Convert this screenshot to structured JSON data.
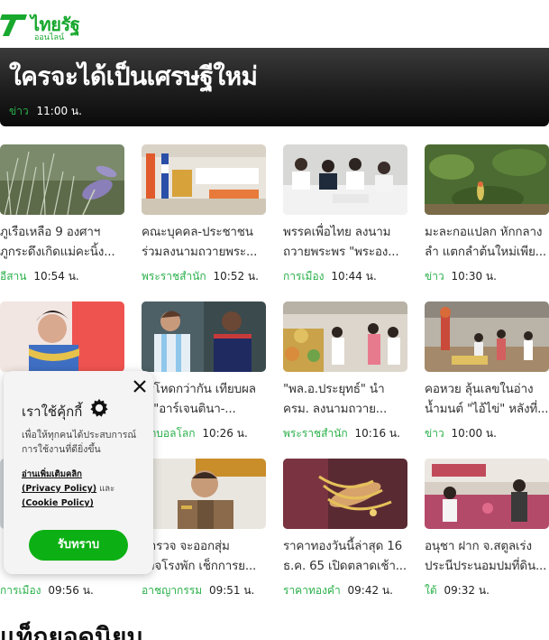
{
  "brand": {
    "name": "ไทยรัฐ",
    "sub": "ออนไลน์",
    "color": "#18a82e"
  },
  "hero": {
    "title": "ใครจะได้เป็นเศรษฐีใหม่",
    "category": "ข่าว",
    "time": "11:00 น."
  },
  "articles": [
    {
      "title_lines": [
        "ภูเรือเหลือ 9 องศาฯ",
        "ภูกระดึงเกิดแม่คะนิ้ง..."
      ],
      "category": "อีสาน",
      "time": "10:54 น."
    },
    {
      "title_lines": [
        "คณะบุคคล-ประชาชน",
        "ร่วมลงนามถวายพระ..."
      ],
      "category": "พระราชสำนัก",
      "time": "10:52 น."
    },
    {
      "title_lines": [
        "พรรคเพื่อไทย ลงนาม",
        "ถวายพระพร \"พระอง..."
      ],
      "category": "การเมือง",
      "time": "10:44 น."
    },
    {
      "title_lines": [
        "มะละกอแปลก หักกลาง",
        "ลำ แตกลำต้นใหม่เพีย..."
      ],
      "category": "ข่าว",
      "time": "10:30 น."
    },
    {
      "title_lines": [
        "",
        ""
      ],
      "category": "",
      "time": ""
    },
    {
      "title_lines": [
        "ไรโหดกว่ากัน เทียบผล",
        "น \"อาร์เจนตินา-..."
      ],
      "category": "ฟุตบอลโลก",
      "time": "10:26 น."
    },
    {
      "title_lines": [
        "\"พล.อ.ประยุทธ์\" นำ",
        "ครม. ลงนามถวาย..."
      ],
      "category": "พระราชสำนัก",
      "time": "10:16 น."
    },
    {
      "title_lines": [
        "คอหวย ลุ้นเลขในอ่าง",
        "น้ำมนต์ \"ไอ้ไข่\" หลังที่..."
      ],
      "category": "ข่าว",
      "time": "10:00 น."
    },
    {
      "title_lines": [
        "",
        ""
      ],
      "category": "การเมือง",
      "time": "09:56 น."
    },
    {
      "title_lines": [
        "ตำรวจ จะออกสุ่ม",
        "รวจโรงพัก เช็กการย..."
      ],
      "category": "อาชญากรรม",
      "time": "09:51 น."
    },
    {
      "title_lines": [
        "ราคาทองวันนี้ล่าสุด 16",
        "ธ.ค. 65 เปิดตลาดเช้า..."
      ],
      "category": "ราคาทองคำ",
      "time": "09:42 น."
    },
    {
      "title_lines": [
        "อนุชา ฝาก จ.สตูลเร่ง",
        "ประนีประนอมปมที่ดิน..."
      ],
      "category": "ใต้",
      "time": "09:32 น."
    }
  ],
  "section": {
    "heading": "แท็กยอดนิยม"
  },
  "cookie": {
    "title": "เราใช้คุ้กกี้",
    "description": "เพื่อให้ทุกคนได้ประสบการณ์การใช้งานที่ดียิ่งขึ้น",
    "read_more": "อ่านเพิ่มเติมคลิก",
    "privacy_link": "(Privacy Policy)",
    "and": "และ",
    "cookie_link": "(Cookie Policy)",
    "accept_label": "รับทราบ",
    "accent": "#0cb014"
  },
  "colors": {
    "category": "#2ab04a",
    "hero_bg": "#1d1d1d"
  }
}
